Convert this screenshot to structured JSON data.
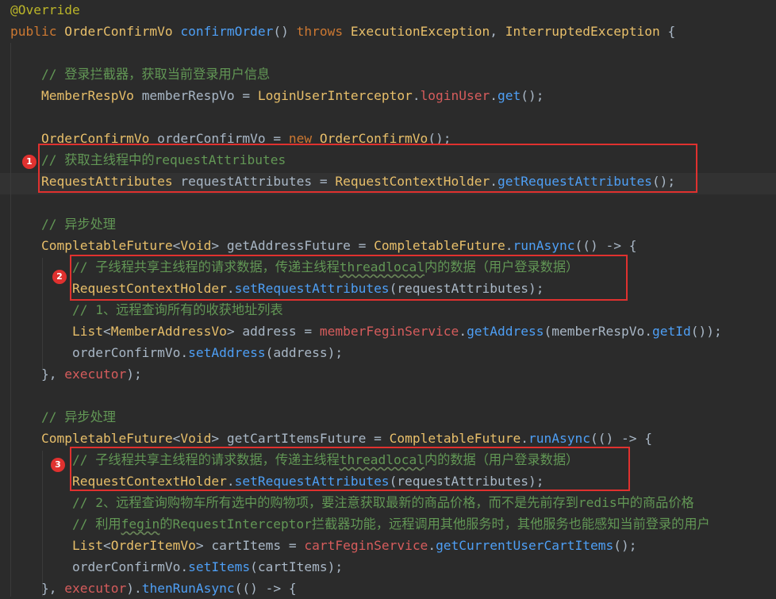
{
  "editor": {
    "lines": [
      [
        {
          "t": "@Override",
          "c": "an"
        }
      ],
      [
        {
          "t": "public ",
          "c": "kw"
        },
        {
          "t": "OrderConfirmVo ",
          "c": "ty"
        },
        {
          "t": "confirmOrder",
          "c": "fn"
        },
        {
          "t": "() ",
          "c": "pl"
        },
        {
          "t": "throws ",
          "c": "kw"
        },
        {
          "t": "ExecutionException",
          "c": "ty"
        },
        {
          "t": ", ",
          "c": "pl"
        },
        {
          "t": "InterruptedException",
          "c": "ty"
        },
        {
          "t": " {",
          "c": "pl"
        }
      ],
      [],
      [
        {
          "t": "    // 登录拦截器，获取当前登录用户信息",
          "c": "cm"
        }
      ],
      [
        {
          "t": "    MemberRespVo ",
          "c": "ty"
        },
        {
          "t": "memberRespVo",
          "c": "id"
        },
        {
          "t": " = ",
          "c": "pl"
        },
        {
          "t": "LoginUserInterceptor",
          "c": "ty"
        },
        {
          "t": ".",
          "c": "pl"
        },
        {
          "t": "loginUser",
          "c": "fd"
        },
        {
          "t": ".",
          "c": "pl"
        },
        {
          "t": "get",
          "c": "fn"
        },
        {
          "t": "();",
          "c": "pl"
        }
      ],
      [],
      [
        {
          "t": "    OrderConfirmVo ",
          "c": "ty"
        },
        {
          "t": "orderConfirmVo",
          "c": "id"
        },
        {
          "t": " = ",
          "c": "pl"
        },
        {
          "t": "new ",
          "c": "kw"
        },
        {
          "t": "OrderConfirmVo",
          "c": "ty"
        },
        {
          "t": "();",
          "c": "pl"
        }
      ],
      [
        {
          "t": "    // 获取主线程中的requestAttributes",
          "c": "cm"
        }
      ],
      [
        {
          "t": "    RequestAttributes ",
          "c": "ty"
        },
        {
          "t": "requestAttributes",
          "c": "id"
        },
        {
          "t": " = ",
          "c": "pl"
        },
        {
          "t": "RequestContextHolder",
          "c": "ty"
        },
        {
          "t": ".",
          "c": "pl"
        },
        {
          "t": "getRequestAttributes",
          "c": "fn"
        },
        {
          "t": "();",
          "c": "pl"
        }
      ],
      [],
      [
        {
          "t": "    // 异步处理",
          "c": "cm"
        }
      ],
      [
        {
          "t": "    CompletableFuture",
          "c": "ty"
        },
        {
          "t": "<",
          "c": "pl"
        },
        {
          "t": "Void",
          "c": "ty"
        },
        {
          "t": "> ",
          "c": "pl"
        },
        {
          "t": "getAddressFuture",
          "c": "id"
        },
        {
          "t": " = ",
          "c": "pl"
        },
        {
          "t": "CompletableFuture",
          "c": "ty"
        },
        {
          "t": ".",
          "c": "pl"
        },
        {
          "t": "runAsync",
          "c": "fn"
        },
        {
          "t": "(() -> {",
          "c": "pl"
        }
      ],
      [
        {
          "t": "        // 子线程共享主线程的请求数据，传递主线程",
          "c": "cm"
        },
        {
          "t": "threadlocal",
          "c": "cm",
          "sq": true
        },
        {
          "t": "内的数据（用户登录数据）",
          "c": "cm"
        }
      ],
      [
        {
          "t": "        RequestContextHolder",
          "c": "ty"
        },
        {
          "t": ".",
          "c": "pl"
        },
        {
          "t": "setRequestAttributes",
          "c": "fn"
        },
        {
          "t": "(requestAttributes);",
          "c": "pl"
        }
      ],
      [
        {
          "t": "        // 1、远程查询所有的收获地址列表",
          "c": "cm"
        }
      ],
      [
        {
          "t": "        List",
          "c": "ty"
        },
        {
          "t": "<",
          "c": "pl"
        },
        {
          "t": "MemberAddressVo",
          "c": "ty"
        },
        {
          "t": "> ",
          "c": "pl"
        },
        {
          "t": "address",
          "c": "id"
        },
        {
          "t": " = ",
          "c": "pl"
        },
        {
          "t": "memberFeginService",
          "c": "fd"
        },
        {
          "t": ".",
          "c": "pl"
        },
        {
          "t": "getAddress",
          "c": "fn"
        },
        {
          "t": "(memberRespVo.",
          "c": "pl"
        },
        {
          "t": "getId",
          "c": "fn"
        },
        {
          "t": "());",
          "c": "pl"
        }
      ],
      [
        {
          "t": "        orderConfirmVo.",
          "c": "pl"
        },
        {
          "t": "setAddress",
          "c": "fn"
        },
        {
          "t": "(address);",
          "c": "pl"
        }
      ],
      [
        {
          "t": "    }, ",
          "c": "pl"
        },
        {
          "t": "executor",
          "c": "fd"
        },
        {
          "t": ");",
          "c": "pl"
        }
      ],
      [],
      [
        {
          "t": "    // 异步处理",
          "c": "cm"
        }
      ],
      [
        {
          "t": "    CompletableFuture",
          "c": "ty"
        },
        {
          "t": "<",
          "c": "pl"
        },
        {
          "t": "Void",
          "c": "ty"
        },
        {
          "t": "> ",
          "c": "pl"
        },
        {
          "t": "getCartItemsFuture",
          "c": "id"
        },
        {
          "t": " = ",
          "c": "pl"
        },
        {
          "t": "CompletableFuture",
          "c": "ty"
        },
        {
          "t": ".",
          "c": "pl"
        },
        {
          "t": "runAsync",
          "c": "fn"
        },
        {
          "t": "(() -> {",
          "c": "pl"
        }
      ],
      [
        {
          "t": "        // 子线程共享主线程的请求数据，传递主线程",
          "c": "cm"
        },
        {
          "t": "threadlocal",
          "c": "cm",
          "sq": true
        },
        {
          "t": "内的数据（用户登录数据）",
          "c": "cm"
        }
      ],
      [
        {
          "t": "        RequestContextHolder",
          "c": "ty"
        },
        {
          "t": ".",
          "c": "pl"
        },
        {
          "t": "setRequestAttributes",
          "c": "fn"
        },
        {
          "t": "(requestAttributes);",
          "c": "pl"
        }
      ],
      [
        {
          "t": "        // 2、远程查询购物车所有选中的购物项，要注意获取最新的商品价格，而不是先前存到redis中的商品价格",
          "c": "cm"
        }
      ],
      [
        {
          "t": "        // 利用",
          "c": "cm"
        },
        {
          "t": "fegin",
          "c": "cm",
          "sq": true
        },
        {
          "t": "的RequestInterceptor拦截器功能，远程调用其他服务时，其他服务也能感知当前登录的用户",
          "c": "cm"
        }
      ],
      [
        {
          "t": "        List",
          "c": "ty"
        },
        {
          "t": "<",
          "c": "pl"
        },
        {
          "t": "OrderItemVo",
          "c": "ty"
        },
        {
          "t": "> ",
          "c": "pl"
        },
        {
          "t": "cartItems",
          "c": "id"
        },
        {
          "t": " = ",
          "c": "pl"
        },
        {
          "t": "cartFeginService",
          "c": "fd"
        },
        {
          "t": ".",
          "c": "pl"
        },
        {
          "t": "getCurrentUserCartItems",
          "c": "fn"
        },
        {
          "t": "();",
          "c": "pl"
        }
      ],
      [
        {
          "t": "        orderConfirmVo.",
          "c": "pl"
        },
        {
          "t": "setItems",
          "c": "fn"
        },
        {
          "t": "(cartItems);",
          "c": "pl"
        }
      ],
      [
        {
          "t": "    }, ",
          "c": "pl"
        },
        {
          "t": "executor",
          "c": "fd"
        },
        {
          "t": ").",
          "c": "pl"
        },
        {
          "t": "thenRunAsync",
          "c": "fn"
        },
        {
          "t": "(() -> {",
          "c": "pl"
        }
      ]
    ]
  },
  "annotations": [
    {
      "label": "1"
    },
    {
      "label": "2"
    },
    {
      "label": "3"
    }
  ],
  "colors": {
    "background": "#2b2b2b",
    "keyword": "#cc7832",
    "comment": "#629755",
    "type": "#e8bf6a",
    "method": "#4e9ff5",
    "field": "#d65c5c",
    "annotation": "#bbb529",
    "plain": "#a9b7c6",
    "highlight_box": "#e0312f"
  }
}
